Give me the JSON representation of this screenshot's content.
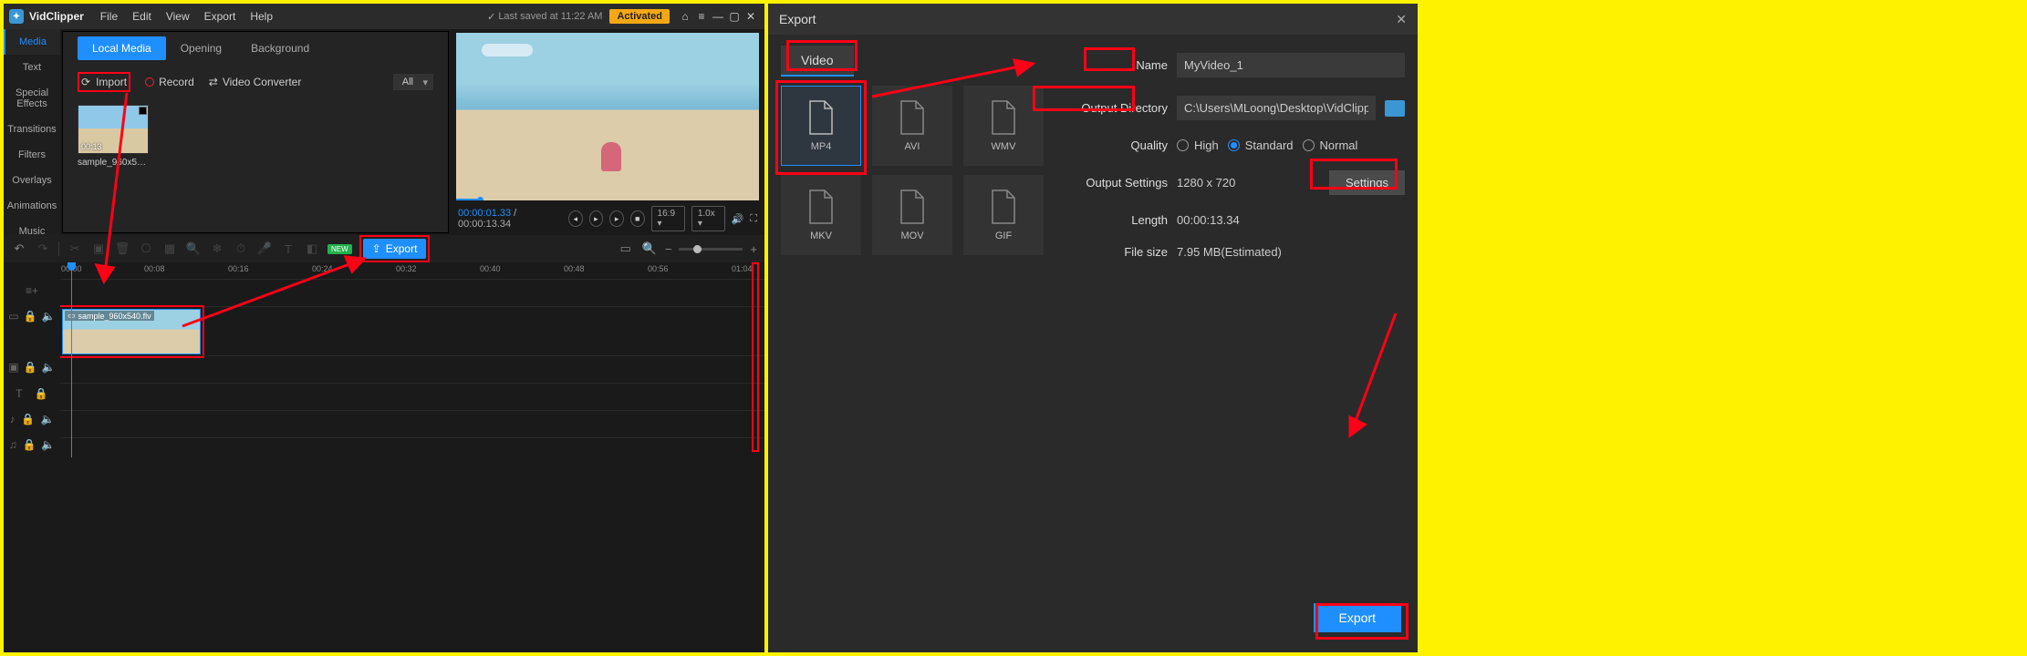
{
  "app": {
    "name": "VidClipper",
    "saved": "Last saved at 11:22 AM",
    "activated": "Activated"
  },
  "menu": {
    "file": "File",
    "edit": "Edit",
    "view": "View",
    "export": "Export",
    "help": "Help"
  },
  "tabs": {
    "local": "Local Media",
    "opening": "Opening",
    "background": "Background"
  },
  "tools": {
    "import": "Import",
    "record": "Record",
    "converter": "Video Converter",
    "all": "All"
  },
  "side": {
    "media": "Media",
    "text": "Text",
    "effects": "Special Effects",
    "transitions": "Transitions",
    "filters": "Filters",
    "overlays": "Overlays",
    "animations": "Animations",
    "music": "Music"
  },
  "clip": {
    "duration": "00:13",
    "name": "sample_960x540...",
    "tl_name": "sample_960x540.flv"
  },
  "preview": {
    "cur": "00:00:01.33",
    "total": "00:00:13.34",
    "aspect": "16:9",
    "speed": "1.0x"
  },
  "tlbar": {
    "export": "Export"
  },
  "ruler": {
    "t0": "00:00",
    "t1": "00:08",
    "t2": "00:16",
    "t3": "00:24",
    "t4": "00:32",
    "t5": "00:40",
    "t6": "00:48",
    "t7": "00:56",
    "t8": "01:04"
  },
  "right": {
    "title": "Export",
    "tab_video": "Video",
    "fmt": {
      "mp4": "MP4",
      "avi": "AVI",
      "wmv": "WMV",
      "mkv": "MKV",
      "mov": "MOV",
      "gif": "GIF"
    },
    "labels": {
      "name": "Name",
      "outdir": "Output Directory",
      "quality": "Quality",
      "outset": "Output Settings",
      "length": "Length",
      "filesize": "File size",
      "settings": "Settings",
      "export": "Export"
    },
    "quality": {
      "high": "High",
      "standard": "Standard",
      "normal": "Normal"
    },
    "values": {
      "name": "MyVideo_1",
      "outdir": "C:\\Users\\MLoong\\Desktop\\VidClipper\\",
      "outset": "1280 x 720",
      "length": "00:00:13.34",
      "filesize": "7.95 MB(Estimated)"
    }
  }
}
